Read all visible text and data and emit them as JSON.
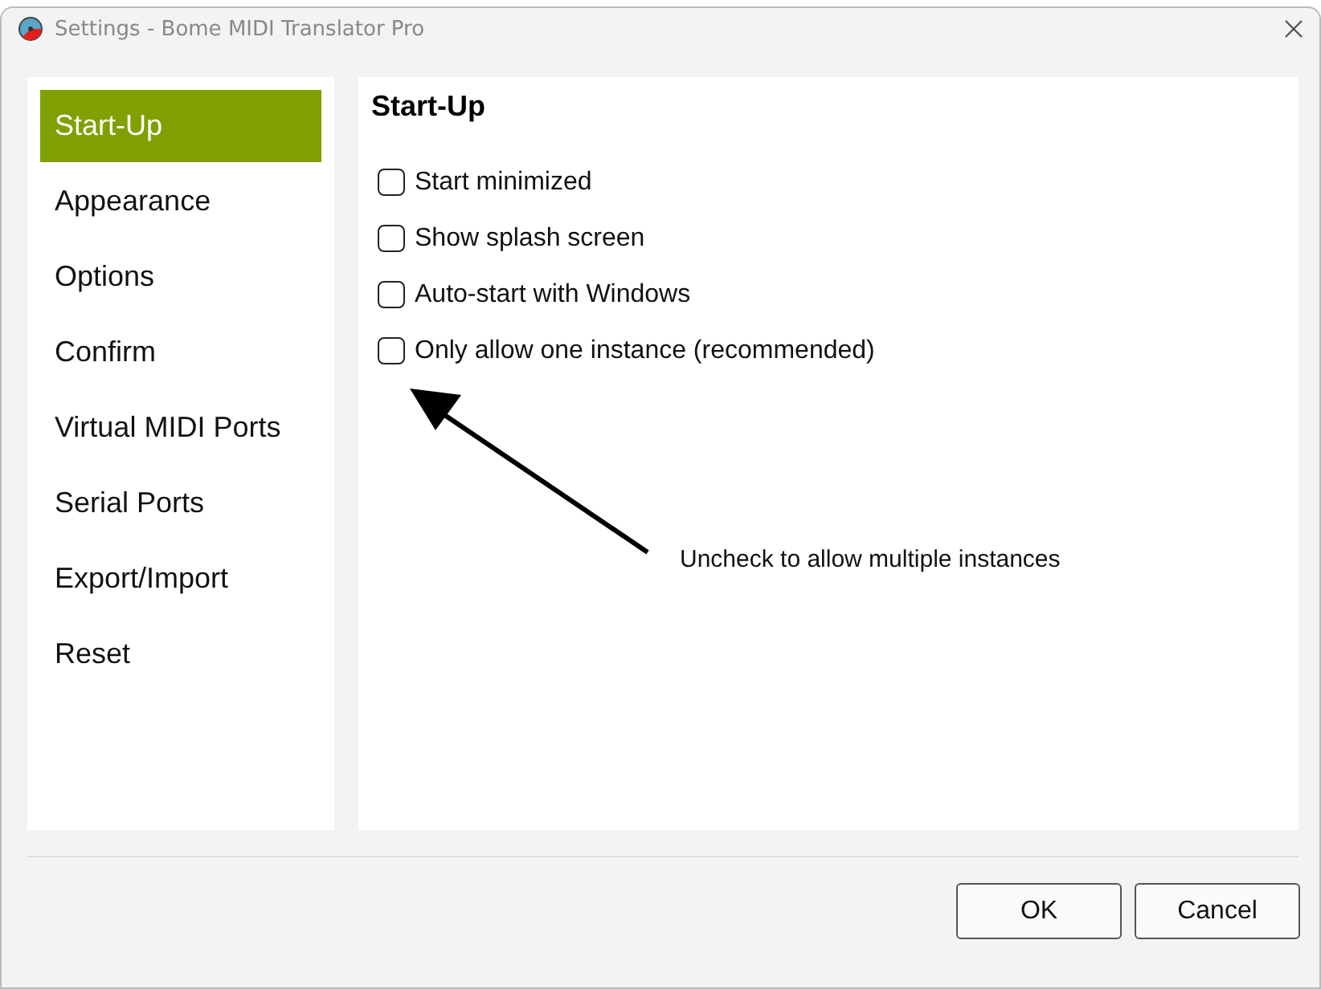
{
  "window": {
    "title": "Settings - Bome MIDI Translator Pro"
  },
  "sidebar": {
    "items": [
      {
        "label": "Start-Up",
        "selected": true
      },
      {
        "label": "Appearance",
        "selected": false
      },
      {
        "label": "Options",
        "selected": false
      },
      {
        "label": "Confirm",
        "selected": false
      },
      {
        "label": "Virtual MIDI Ports",
        "selected": false
      },
      {
        "label": "Serial Ports",
        "selected": false
      },
      {
        "label": "Export/Import",
        "selected": false
      },
      {
        "label": "Reset",
        "selected": false
      }
    ]
  },
  "panel": {
    "heading": "Start-Up",
    "options": [
      {
        "label": "Start minimized",
        "checked": false
      },
      {
        "label": "Show splash screen",
        "checked": false
      },
      {
        "label": "Auto-start with Windows",
        "checked": false
      },
      {
        "label": "Only allow one instance (recommended)",
        "checked": false
      }
    ],
    "annotation": "Uncheck to allow multiple instances"
  },
  "buttons": [
    "OK",
    "Cancel"
  ]
}
